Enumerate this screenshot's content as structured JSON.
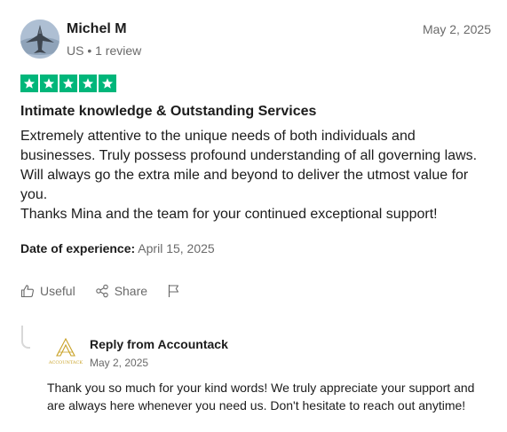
{
  "review": {
    "author_name": "Michel M",
    "author_meta": "US • 1 review",
    "date": "May 2, 2025",
    "rating": 5,
    "title": "Intimate knowledge & Outstanding Services",
    "body_lines": [
      "Extremely attentive to the unique needs of both individuals and businesses. Truly possess profound understanding of all governing laws. Will always go the extra mile and beyond to deliver the utmost value for you.",
      "Thanks Mina and the team for your continued exceptional support!"
    ],
    "experience_label": "Date of experience:",
    "experience_date": "April 15, 2025"
  },
  "actions": {
    "useful_label": "Useful",
    "share_label": "Share"
  },
  "reply": {
    "from_label": "Reply from Accountack",
    "logo_text": "ACCOUNTACK",
    "date": "May 2, 2025",
    "text": "Thank you so much for your kind words! We truly appreciate your support and are always here whenever you need us. Don't hesitate to reach out anytime!"
  },
  "colors": {
    "star_green": "#00b67a",
    "text": "#1c1c1c",
    "muted": "#6a6a6a",
    "logo_gold": "#c9a227"
  }
}
